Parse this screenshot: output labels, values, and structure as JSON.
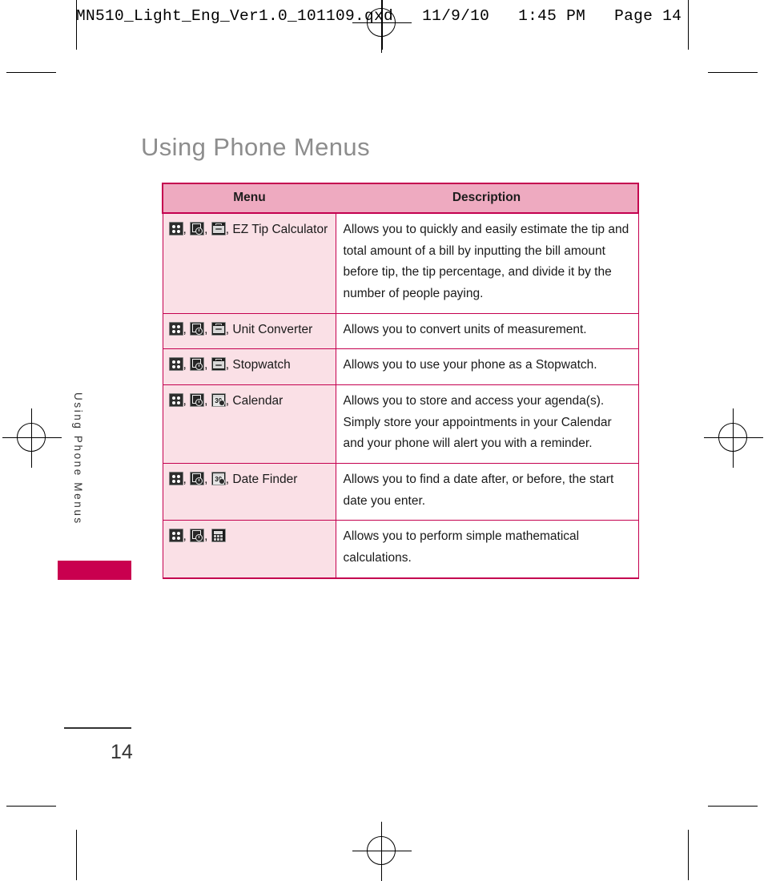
{
  "prepress": {
    "slug": "MN510_Light_Eng_Ver1.0_101109.qxd   11/9/10   1:45 PM   Page 14"
  },
  "page": {
    "title": "Using Phone Menus",
    "side_tab_label": "Using Phone Menus",
    "folio": "14"
  },
  "table": {
    "headers": {
      "menu": "Menu",
      "description": "Description"
    },
    "rows": [
      {
        "icons": [
          "grid-icon",
          "tools-clock-icon",
          "briefcase-icon"
        ],
        "label": "EZ Tip Calculator",
        "description": "Allows you to quickly and easily estimate the tip and total amount of a bill by inputting the bill amount before tip, the tip percentage, and divide it by the number of people paying."
      },
      {
        "icons": [
          "grid-icon",
          "tools-clock-icon",
          "briefcase-icon"
        ],
        "label": "Unit Converter",
        "description": "Allows you to convert units of measurement."
      },
      {
        "icons": [
          "grid-icon",
          "tools-clock-icon",
          "briefcase-icon"
        ],
        "label": "Stopwatch",
        "description": "Allows you to use your phone as a Stopwatch."
      },
      {
        "icons": [
          "grid-icon",
          "tools-clock-icon",
          "calendar-icon"
        ],
        "label": "Calendar",
        "description": "Allows you to store and access your agenda(s). Simply store your appointments in your Calendar and your phone will alert you with a reminder."
      },
      {
        "icons": [
          "grid-icon",
          "tools-clock-icon",
          "calendar-icon"
        ],
        "label": "Date Finder",
        "description": "Allows you to find a date after, or before, the start date you enter."
      },
      {
        "icons": [
          "grid-icon",
          "tools-clock-icon",
          "calculator-icon"
        ],
        "label": "",
        "description": "Allows you to perform simple mathematical calculations."
      }
    ],
    "separator": ", ",
    "calendar_icon_number": "30",
    "colors": {
      "header_fill": "#eeaac0",
      "row_fill": "#fae0e6",
      "border": "#c4004f",
      "tab_bar": "#c9004f",
      "title_gray": "#8d8d8d"
    }
  }
}
